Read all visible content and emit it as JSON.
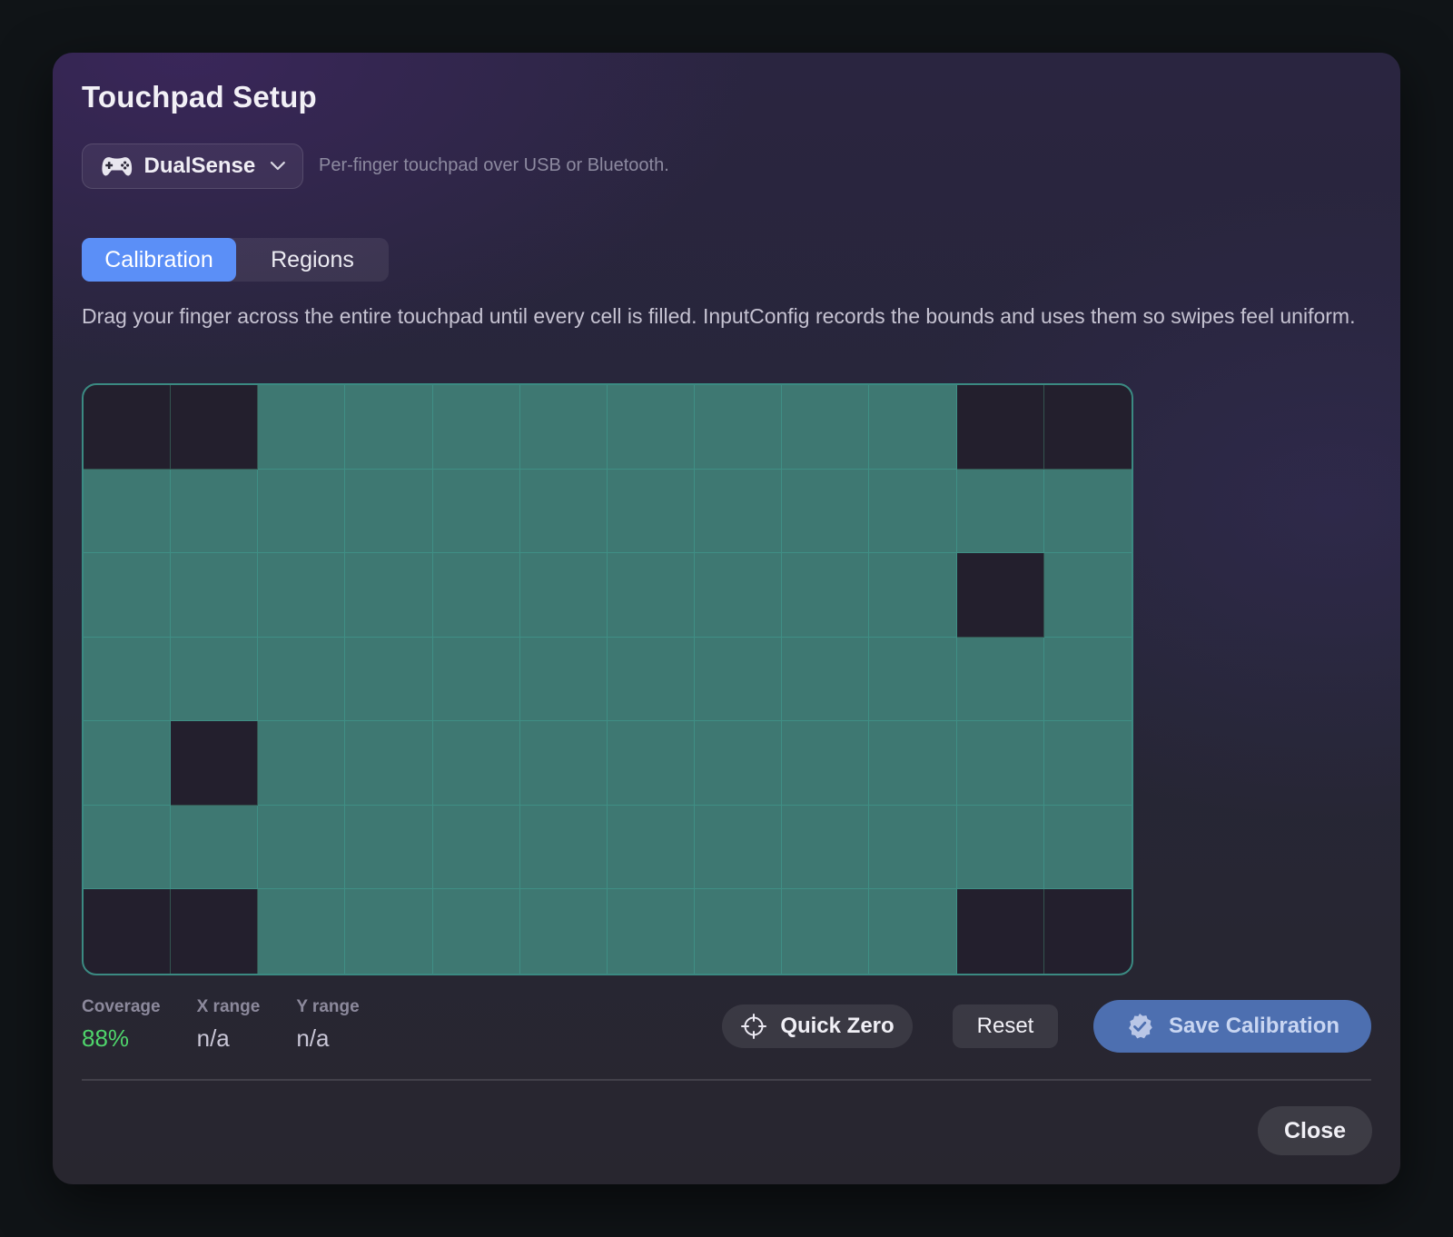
{
  "dialog": {
    "title": "Touchpad Setup"
  },
  "device": {
    "icon": "gamepad-icon",
    "selected": "DualSense",
    "hint": "Per-finger touchpad over USB or Bluetooth."
  },
  "tabs": [
    {
      "label": "Calibration",
      "active": true
    },
    {
      "label": "Regions",
      "active": false
    }
  ],
  "instructions": "Drag your finger across the entire touchpad until every cell is filled. InputConfig records the bounds and uses them so swipes feel uniform.",
  "calibration_grid": {
    "columns": 12,
    "rows": 7,
    "empty_cells": [
      [
        0,
        0
      ],
      [
        0,
        1
      ],
      [
        0,
        10
      ],
      [
        0,
        11
      ],
      [
        2,
        10
      ],
      [
        4,
        1
      ],
      [
        6,
        0
      ],
      [
        6,
        1
      ],
      [
        6,
        10
      ],
      [
        6,
        11
      ]
    ]
  },
  "stats": {
    "coverage_label": "Coverage",
    "coverage_value": "88%",
    "xrange_label": "X range",
    "xrange_value": "n/a",
    "yrange_label": "Y range",
    "yrange_value": "n/a"
  },
  "actions": {
    "quick_zero": "Quick Zero",
    "reset": "Reset",
    "save": "Save Calibration",
    "close": "Close"
  },
  "colors": {
    "accent": "#5b8ff7",
    "filled_cell": "#3e7872",
    "empty_cell": "#231f2d",
    "coverage_good": "#4fd46b",
    "save_button": "#4d6fb0"
  }
}
